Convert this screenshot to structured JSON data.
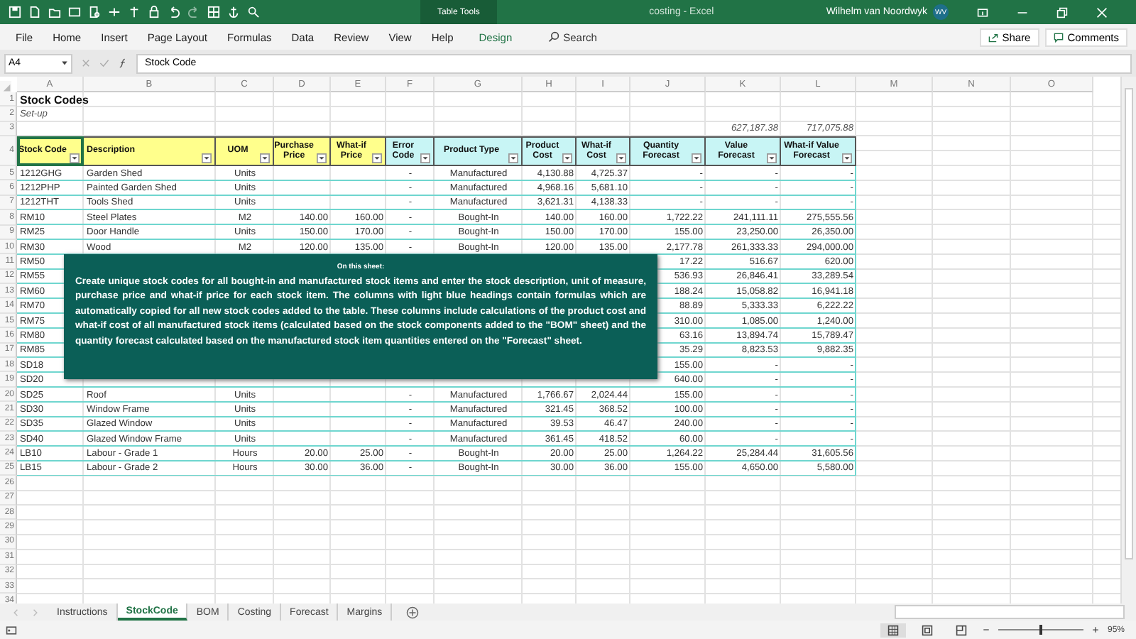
{
  "window": {
    "contextual_label": "Table Tools",
    "title": "costing  -  Excel",
    "user": "Wilhelm van Noordwyk",
    "initials": "WV"
  },
  "ribbon": {
    "tabs": [
      {
        "label": "File",
        "kind": "normal"
      },
      {
        "label": "Home",
        "kind": "normal"
      },
      {
        "label": "Insert",
        "kind": "normal"
      },
      {
        "label": "Page Layout",
        "kind": "normal"
      },
      {
        "label": "Formulas",
        "kind": "normal"
      },
      {
        "label": "Data",
        "kind": "normal"
      },
      {
        "label": "Review",
        "kind": "normal"
      },
      {
        "label": "View",
        "kind": "normal"
      },
      {
        "label": "Help",
        "kind": "normal"
      },
      {
        "label": "Design",
        "kind": "contextual"
      }
    ],
    "search": {
      "placeholder": "Search"
    },
    "share": "Share",
    "comments": "Comments"
  },
  "formula_bar": {
    "name_box": "A4",
    "value": "Stock Code"
  },
  "sheet": {
    "column_letters": [
      "A",
      "B",
      "C",
      "D",
      "E",
      "F",
      "G",
      "H",
      "I",
      "J",
      "K",
      "L",
      "M",
      "N",
      "O"
    ],
    "table_columns": [
      {
        "label": "Stock Code",
        "kind": "input",
        "selected": true
      },
      {
        "label": "Description",
        "kind": "input",
        "selected": false
      },
      {
        "label": "UOM",
        "kind": "input",
        "selected": false
      },
      {
        "label": "Purchase Price",
        "kind": "input",
        "selected": false
      },
      {
        "label": "What-if Price",
        "kind": "input",
        "selected": false
      },
      {
        "label": "Error Code",
        "kind": "formula",
        "selected": false
      },
      {
        "label": "Product Type",
        "kind": "formula",
        "selected": false
      },
      {
        "label": "Product Cost",
        "kind": "formula",
        "selected": false
      },
      {
        "label": "What-if Cost",
        "kind": "formula",
        "selected": false
      },
      {
        "label": "Quantity Forecast",
        "kind": "formula",
        "selected": false
      },
      {
        "label": "Value Forecast",
        "kind": "formula",
        "selected": false
      },
      {
        "label": "What-if Value Forecast",
        "kind": "formula",
        "selected": false
      }
    ],
    "rows": [
      {
        "number": "1",
        "kind": "title",
        "cells": {
          "A": "Stock Codes"
        }
      },
      {
        "number": "2",
        "kind": "subtitle",
        "cells": {
          "A": "Set-up"
        }
      },
      {
        "number": "3",
        "kind": "totals",
        "cells": {
          "K": "627,187.38",
          "L": "717,075.88"
        }
      },
      {
        "number": "4",
        "kind": "header"
      },
      {
        "number": "5",
        "kind": "data",
        "cells": {
          "A": "1212GHG",
          "B": "Garden Shed",
          "C": "Units",
          "F": "-",
          "G": "Manufactured",
          "H": "4,130.88",
          "I": "4,725.37",
          "J": "-",
          "K": "-",
          "L": "-"
        }
      },
      {
        "number": "6",
        "kind": "data",
        "cells": {
          "A": "1212PHP",
          "B": "Painted Garden Shed",
          "C": "Units",
          "F": "-",
          "G": "Manufactured",
          "H": "4,968.16",
          "I": "5,681.10",
          "J": "-",
          "K": "-",
          "L": "-"
        }
      },
      {
        "number": "7",
        "kind": "data",
        "cells": {
          "A": "1212THT",
          "B": "Tools Shed",
          "C": "Units",
          "F": "-",
          "G": "Manufactured",
          "H": "3,621.31",
          "I": "4,138.33",
          "J": "-",
          "K": "-",
          "L": "-"
        }
      },
      {
        "number": "8",
        "kind": "data",
        "cells": {
          "A": "RM10",
          "B": "Steel Plates",
          "C": "M2",
          "D": "140.00",
          "E": "160.00",
          "F": "-",
          "G": "Bought-In",
          "H": "140.00",
          "I": "160.00",
          "J": "1,722.22",
          "K": "241,111.11",
          "L": "275,555.56"
        }
      },
      {
        "number": "9",
        "kind": "data",
        "cells": {
          "A": "RM25",
          "B": "Door Handle",
          "C": "Units",
          "D": "150.00",
          "E": "170.00",
          "F": "-",
          "G": "Bought-In",
          "H": "150.00",
          "I": "170.00",
          "J": "155.00",
          "K": "23,250.00",
          "L": "26,350.00"
        }
      },
      {
        "number": "10",
        "kind": "data",
        "cells": {
          "A": "RM30",
          "B": "Wood",
          "C": "M2",
          "D": "120.00",
          "E": "135.00",
          "F": "-",
          "G": "Bought-In",
          "H": "120.00",
          "I": "135.00",
          "J": "2,177.78",
          "K": "261,333.33",
          "L": "294,000.00"
        }
      },
      {
        "number": "11",
        "kind": "data",
        "cells": {
          "A": "RM50",
          "J": "17.22",
          "K": "516.67",
          "L": "620.00"
        }
      },
      {
        "number": "12",
        "kind": "data",
        "cells": {
          "A": "RM55",
          "J": "536.93",
          "K": "26,846.41",
          "L": "33,289.54"
        }
      },
      {
        "number": "13",
        "kind": "data",
        "cells": {
          "A": "RM60",
          "J": "188.24",
          "K": "15,058.82",
          "L": "16,941.18"
        }
      },
      {
        "number": "14",
        "kind": "data",
        "cells": {
          "A": "RM70",
          "J": "88.89",
          "K": "5,333.33",
          "L": "6,222.22"
        }
      },
      {
        "number": "15",
        "kind": "data",
        "cells": {
          "A": "RM75",
          "J": "310.00",
          "K": "1,085.00",
          "L": "1,240.00"
        }
      },
      {
        "number": "16",
        "kind": "data",
        "cells": {
          "A": "RM80",
          "J": "63.16",
          "K": "13,894.74",
          "L": "15,789.47"
        }
      },
      {
        "number": "17",
        "kind": "data",
        "cells": {
          "A": "RM85",
          "J": "35.29",
          "K": "8,823.53",
          "L": "9,882.35"
        }
      },
      {
        "number": "18",
        "kind": "data",
        "cells": {
          "A": "SD18",
          "J": "155.00",
          "K": "-",
          "L": "-"
        }
      },
      {
        "number": "19",
        "kind": "data",
        "cells": {
          "A": "SD20",
          "J": "640.00",
          "K": "-",
          "L": "-"
        }
      },
      {
        "number": "20",
        "kind": "data",
        "cells": {
          "A": "SD25",
          "B": "Roof",
          "C": "Units",
          "F": "-",
          "G": "Manufactured",
          "H": "1,766.67",
          "I": "2,024.44",
          "J": "155.00",
          "K": "-",
          "L": "-"
        }
      },
      {
        "number": "21",
        "kind": "data",
        "cells": {
          "A": "SD30",
          "B": "Window Frame",
          "C": "Units",
          "F": "-",
          "G": "Manufactured",
          "H": "321.45",
          "I": "368.52",
          "J": "100.00",
          "K": "-",
          "L": "-"
        }
      },
      {
        "number": "22",
        "kind": "data",
        "cells": {
          "A": "SD35",
          "B": "Glazed Window",
          "C": "Units",
          "F": "-",
          "G": "Manufactured",
          "H": "39.53",
          "I": "46.47",
          "J": "240.00",
          "K": "-",
          "L": "-"
        }
      },
      {
        "number": "23",
        "kind": "data",
        "cells": {
          "A": "SD40",
          "B": "Glazed Window Frame",
          "C": "Units",
          "F": "-",
          "G": "Manufactured",
          "H": "361.45",
          "I": "418.52",
          "J": "60.00",
          "K": "-",
          "L": "-"
        }
      },
      {
        "number": "24",
        "kind": "data",
        "cells": {
          "A": "LB10",
          "B": "Labour - Grade 1",
          "C": "Hours",
          "D": "20.00",
          "E": "25.00",
          "F": "-",
          "G": "Bought-In",
          "H": "20.00",
          "I": "25.00",
          "J": "1,264.22",
          "K": "25,284.44",
          "L": "31,605.56"
        }
      },
      {
        "number": "25",
        "kind": "data",
        "cells": {
          "A": "LB15",
          "B": "Labour - Grade 2",
          "C": "Hours",
          "D": "30.00",
          "E": "36.00",
          "F": "-",
          "G": "Bought-In",
          "H": "30.00",
          "I": "36.00",
          "J": "155.00",
          "K": "4,650.00",
          "L": "5,580.00"
        }
      },
      {
        "number": "26",
        "kind": "empty"
      },
      {
        "number": "27",
        "kind": "empty"
      },
      {
        "number": "28",
        "kind": "empty"
      },
      {
        "number": "29",
        "kind": "empty"
      },
      {
        "number": "30",
        "kind": "empty"
      },
      {
        "number": "31",
        "kind": "empty"
      },
      {
        "number": "32",
        "kind": "empty"
      },
      {
        "number": "33",
        "kind": "empty"
      },
      {
        "number": "34",
        "kind": "empty"
      }
    ]
  },
  "note": {
    "title": "On this sheet:",
    "text": "Create unique stock codes for all bought-in and manufactured stock items and enter the stock description, unit of measure, purchase price and what-if price for each stock item. The columns with light blue headings contain formulas which are automatically copied for all new stock codes added to the table. These columns include calculations of the product cost and what-if cost of all manufactured stock items (calculated based on the stock components added to the \"BOM\" sheet) and the quantity forecast calculated based on the manufactured stock item quantities entered on the \"Forecast\" sheet."
  },
  "sheet_tabs": [
    {
      "label": "Instructions",
      "selected": false
    },
    {
      "label": "StockCode",
      "selected": true
    },
    {
      "label": "BOM",
      "selected": false
    },
    {
      "label": "Costing",
      "selected": false
    },
    {
      "label": "Forecast",
      "selected": false
    },
    {
      "label": "Margins",
      "selected": false
    }
  ],
  "status_bar": {
    "zoom": {
      "level": 0.48,
      "reading": "95%"
    }
  }
}
